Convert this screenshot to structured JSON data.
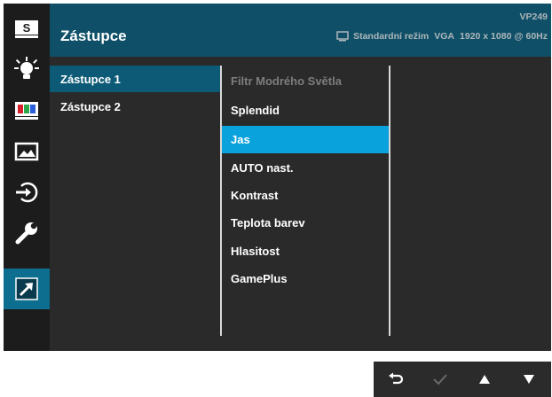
{
  "header": {
    "title": "Zástupce",
    "model": "VP249",
    "mode": "Standardní režim",
    "input": "VGA",
    "resolution": "1920 x 1080 @ 60Hz"
  },
  "sidebar": {
    "items": [
      {
        "icon": "splendid-icon",
        "glyph": "S"
      },
      {
        "icon": "blue-light-filter-icon"
      },
      {
        "icon": "color-icon"
      },
      {
        "icon": "image-icon"
      },
      {
        "icon": "input-select-icon"
      },
      {
        "icon": "system-setup-icon"
      },
      {
        "icon": "shortcut-icon",
        "active": true
      }
    ]
  },
  "menu_level1": {
    "items": [
      {
        "label": "Zástupce 1",
        "selected": true
      },
      {
        "label": "Zástupce 2"
      }
    ]
  },
  "menu_level2": {
    "items": [
      {
        "label": "Filtr Modrého Světla",
        "disabled": true
      },
      {
        "label": "Splendid"
      },
      {
        "label": "Jas",
        "selected": true
      },
      {
        "label": "AUTO nast."
      },
      {
        "label": "Kontrast"
      },
      {
        "label": "Teplota barev"
      },
      {
        "label": "Hlasitost"
      },
      {
        "label": "GamePlus"
      }
    ]
  },
  "navbar": {
    "buttons": [
      "back-icon",
      "confirm-icon",
      "up-arrow-icon",
      "down-arrow-icon"
    ]
  },
  "colors": {
    "accent": "#0aa2dc",
    "header": "#0f5068",
    "selected_row": "#0d5a76",
    "sidebar_active": "#0d6e8f"
  }
}
